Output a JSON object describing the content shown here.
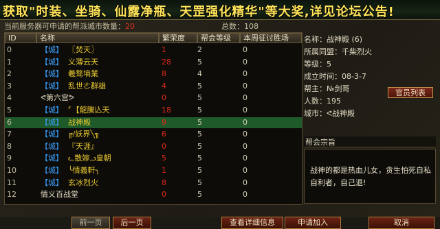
{
  "banner": {
    "text": "获取\"时装、坐骑、仙露净瓶、天罡强化精华\"等大奖,详见论坛公告!"
  },
  "header": {
    "count_label": "当前服务器可申请的帮派城市数量：",
    "count_value": "20",
    "total_label": "总数：108"
  },
  "columns": {
    "id": "ID",
    "name": "名称",
    "prosperity": "繁荣度",
    "level": "帮会等级",
    "wins": "本周征讨胜场"
  },
  "rows": [
    {
      "id": "0",
      "tag": "【城】",
      "name": "〖焚天〗",
      "prosperity": "1",
      "level": "2",
      "wins": "0"
    },
    {
      "id": "1",
      "tag": "【城】",
      "name": "义薄云天",
      "prosperity": "28",
      "level": "5",
      "wins": "0"
    },
    {
      "id": "2",
      "tag": "【城】",
      "name": "羲骜墒業",
      "prosperity": "8",
      "level": "4",
      "wins": "0"
    },
    {
      "id": "3",
      "tag": "【城】",
      "name": "乱世ㄜ群雄",
      "prosperity": "4",
      "level": "5",
      "wins": "0"
    },
    {
      "id": "4",
      "tag": "",
      "name": "ᕙ第六宫ᕗ",
      "prosperity": "0",
      "level": "5",
      "wins": "0"
    },
    {
      "id": "5",
      "tag": "【城】",
      "name": "〞【龍騰亾天",
      "prosperity": "18",
      "level": "5",
      "wins": "0"
    },
    {
      "id": "6",
      "tag": "【城】",
      "name": "战神殿",
      "prosperity": "9",
      "level": "5",
      "wins": "0"
    },
    {
      "id": "7",
      "tag": "【城】",
      "name": "╔/妖界╲╗",
      "prosperity": "6",
      "level": "5",
      "wins": "0"
    },
    {
      "id": "8",
      "tag": "【城】",
      "name": "『天涯』",
      "prosperity": "0",
      "level": "5",
      "wins": "0"
    },
    {
      "id": "9",
      "tag": "【城】",
      "name": "ᓚ散嫁ᓗ皇朝",
      "prosperity": "5",
      "level": "5",
      "wins": "0"
    },
    {
      "id": "10",
      "tag": "【城】",
      "name": "╰情義軒╮",
      "prosperity": "1",
      "level": "5",
      "wins": "0"
    },
    {
      "id": "11",
      "tag": "【城】",
      "name": "玄冰烈火",
      "prosperity": "8",
      "level": "5",
      "wins": "0"
    },
    {
      "id": "12",
      "tag": "",
      "name": "情义百战堂",
      "prosperity": "0",
      "level": "5",
      "wins": "0"
    }
  ],
  "info": {
    "name": "名称：战神殿 (6)",
    "alliance": "所属同盟：千柴烈火",
    "level": "等级：5",
    "founded": "成立时间：08-3-7",
    "leader": "帮主：№剑哥",
    "members": "人数：195",
    "city": "城市：ᕙ战神殿",
    "officer_button": "官员列表",
    "motto_label": "帮会宗旨",
    "motto": "战神的都是热血儿女，贪生怕死自私自利者，自己退!"
  },
  "buttons": {
    "prev": "前一页",
    "next": "后一页",
    "details": "查看详细信息",
    "apply": "申请加入",
    "cancel": "取消"
  }
}
